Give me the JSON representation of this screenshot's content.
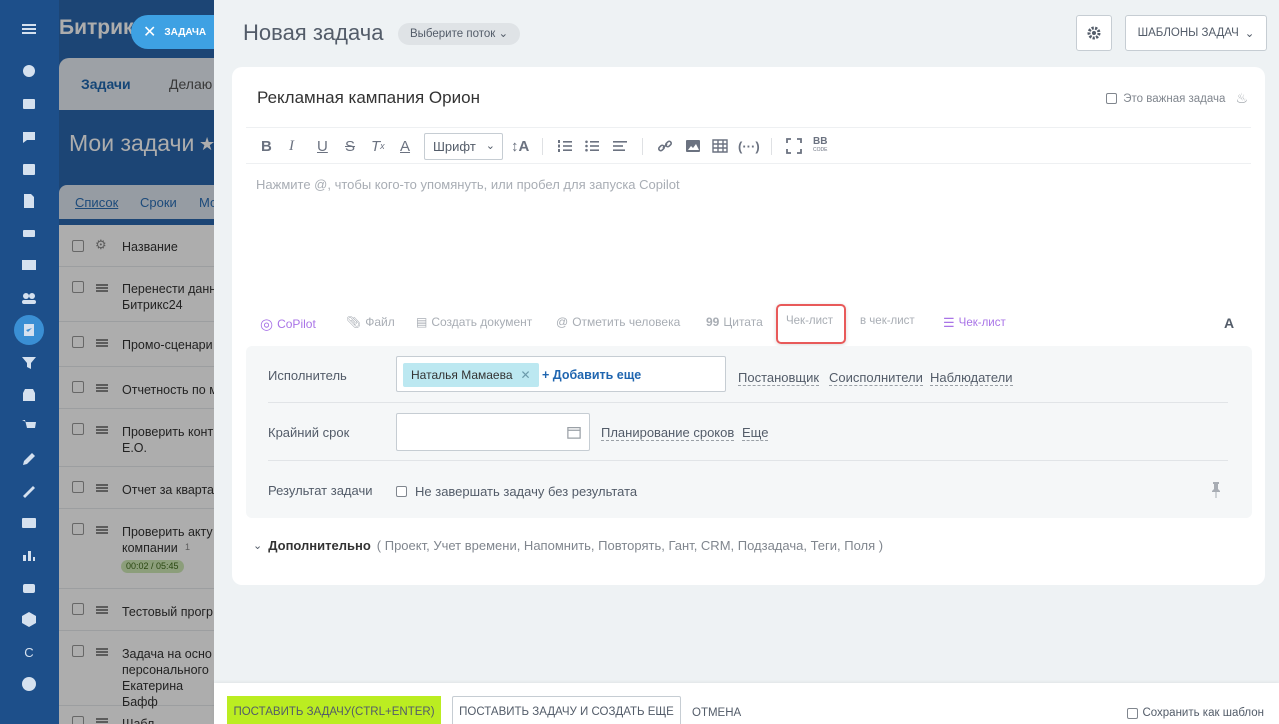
{
  "colors": {
    "accent": "#3ea1e3",
    "primary_button": "#bbed21",
    "highlight": "#e85a5a",
    "copilot": "#a974e7"
  },
  "close_button": {
    "label": "ЗАДАЧА",
    "icon": "close-icon"
  },
  "background": {
    "brand": "Битрик",
    "tabs": [
      "Задачи",
      "Делаю"
    ],
    "page_title": "Мои задачи",
    "subtabs": [
      "Список",
      "Сроки",
      "Мо"
    ],
    "column_header": "Название",
    "rows": [
      {
        "text": "Перенести данн\nБитрикс24"
      },
      {
        "text": "Промо-сценари"
      },
      {
        "text": "Отчетность по м"
      },
      {
        "text": "Проверить конт\nЕ.О."
      },
      {
        "text": "Отчет за кварта"
      },
      {
        "text": "Проверить акту\nкомпании",
        "comments": "1",
        "timer": "00:02 / 05:45"
      },
      {
        "text": "Тестовый прогр"
      },
      {
        "text": "Задача на осно\nперсонального\nЕкатерина Бафф"
      },
      {
        "text": "Шабл"
      }
    ]
  },
  "header": {
    "title": "Новая задача",
    "flow_select": "Выберите поток",
    "templates_button": "ШАБЛОНЫ ЗАДАЧ"
  },
  "task": {
    "title": "Рекламная кампания Орион",
    "important_label": "Это важная задача"
  },
  "toolbar": {
    "font_select": "Шрифт",
    "bb_label": "BB",
    "bb_sub": "CODE"
  },
  "editor": {
    "placeholder": "Нажмите @, чтобы кого-то упомянуть, или пробел для запуска Copilot"
  },
  "attachments": {
    "copilot": "CoPilot",
    "file": "Файл",
    "create_doc": "Создать документ",
    "mention": "Отметить человека",
    "quote": "Цитата",
    "checklist_highlight": "Чек-лист",
    "to_checklist": "в чек-лист",
    "checklist": "Чек-лист",
    "font_toggle": "A"
  },
  "fields": {
    "assignee_label": "Исполнитель",
    "assignee_chip": "Наталья Мамаева",
    "add_more": "+ Добавить еще",
    "creator_link": "Постановщик",
    "coassignees_link": "Соисполнители",
    "observers_link": "Наблюдатели",
    "deadline_label": "Крайний срок",
    "planning_link": "Планирование сроков",
    "more_link": "Еще",
    "result_label": "Результат задачи",
    "result_checkbox": "Не завершать задачу без результата"
  },
  "additional": {
    "label": "Дополнительно",
    "items": "( Проект,  Учет времени,  Напомнить,  Повторять,  Гант,  CRM,  Подзадача,  Теги,  Поля )"
  },
  "footer": {
    "primary": "ПОСТАВИТЬ ЗАДАЧУ(CTRL+ENTER)",
    "secondary": "ПОСТАВИТЬ ЗАДАЧУ И СОЗДАТЬ ЕЩЕ",
    "cancel": "ОТМЕНА",
    "save_template": "Сохранить как шаблон"
  }
}
